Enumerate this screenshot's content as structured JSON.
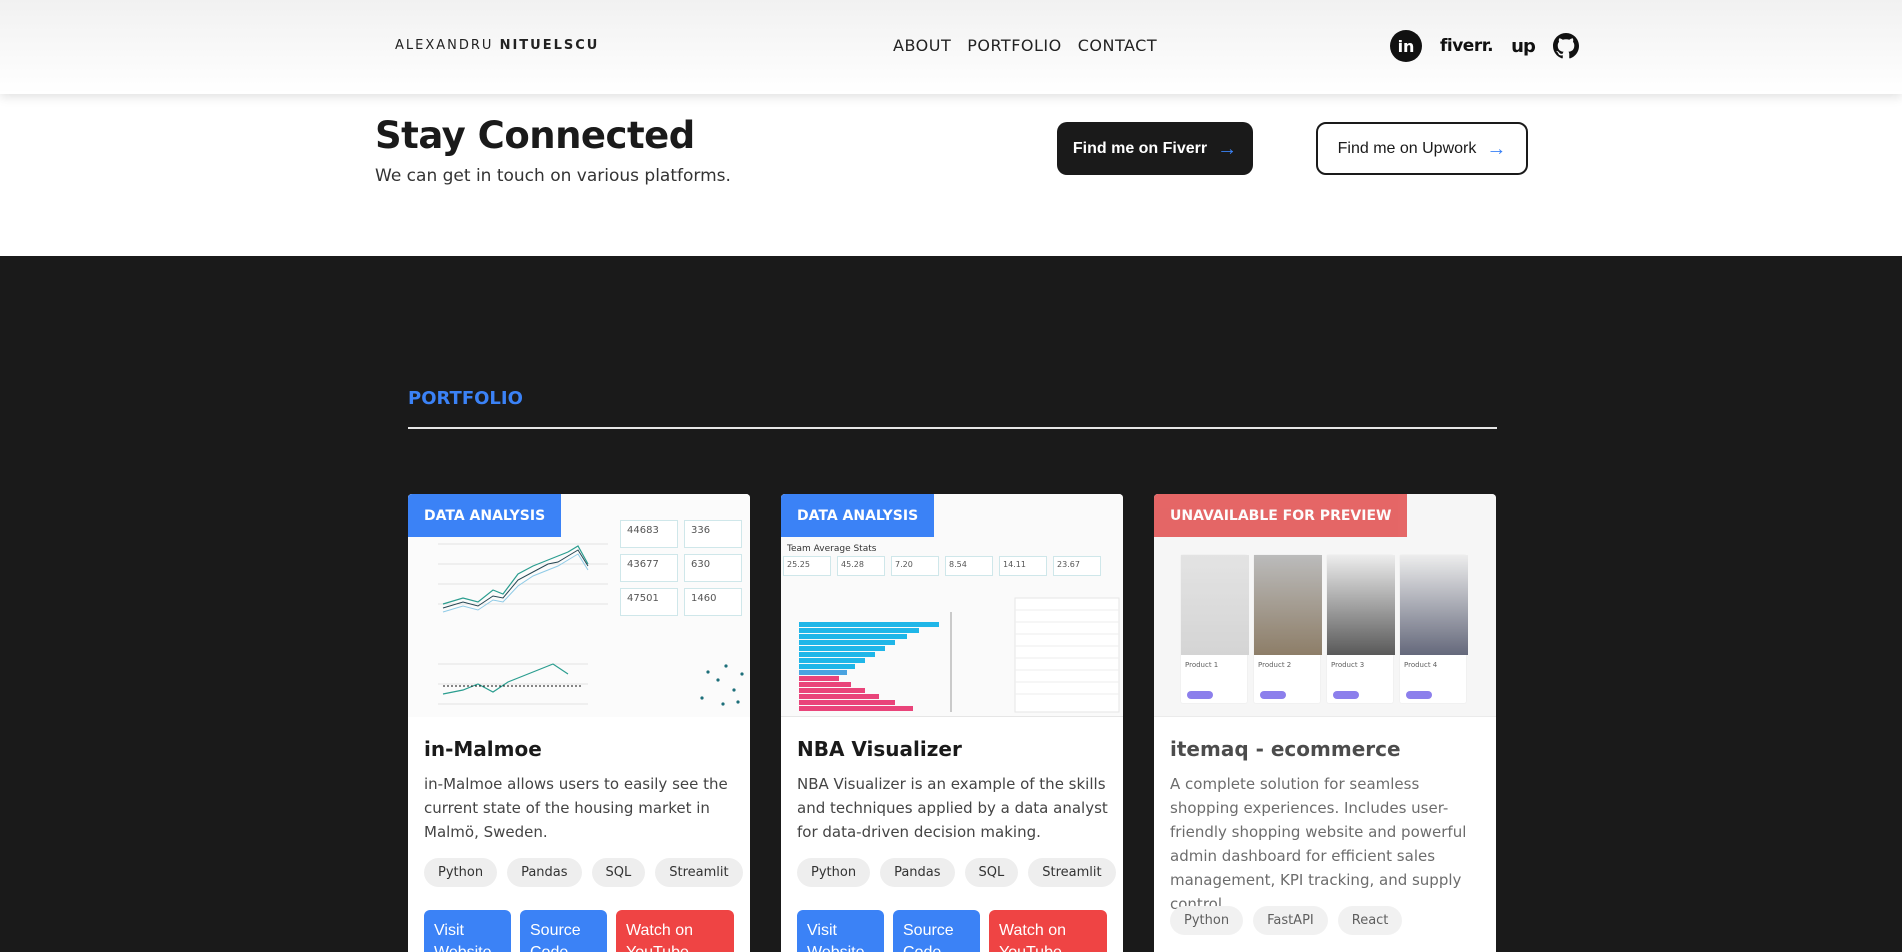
{
  "header": {
    "brand_first": "ALEXANDRU",
    "brand_last": "NITUELSCU",
    "nav": [
      {
        "label": "ABOUT"
      },
      {
        "label": "PORTFOLIO"
      },
      {
        "label": "CONTACT"
      }
    ],
    "socials": {
      "linkedin": "in",
      "fiverr": "fiverr.",
      "upwork": "up"
    }
  },
  "connect": {
    "title": "Stay Connected",
    "subtitle": "We can get in touch on various platforms.",
    "fiverr_button": "Find me on Fiverr",
    "upwork_button": "Find me on Upwork"
  },
  "portfolio": {
    "section_label": "PORTFOLIO",
    "cards": [
      {
        "badge": "DATA ANALYSIS",
        "title": "in-Malmoe",
        "description": "in-Malmoe allows users to easily see the current state of the housing market in Malmö, Sweden.",
        "tags": [
          "Python",
          "Pandas",
          "SQL",
          "Streamlit"
        ],
        "actions": [
          "Visit Website",
          "Source Code",
          "Watch on YouTube"
        ],
        "thumb_stats": [
          "44683",
          "336",
          "43677",
          "630",
          "47501",
          "1460"
        ]
      },
      {
        "badge": "DATA ANALYSIS",
        "title": "NBA Visualizer",
        "description": "NBA Visualizer is an example of the skills and techniques applied by a data analyst for data-driven decision making.",
        "tags": [
          "Python",
          "Pandas",
          "SQL",
          "Streamlit"
        ],
        "actions": [
          "Visit Website",
          "Source Code",
          "Watch on YouTube"
        ],
        "thumb_heading": "Team Average Stats",
        "thumb_stats": [
          "25.25",
          "45.28",
          "7.20",
          "8.54",
          "14.11",
          "23.67"
        ]
      },
      {
        "badge": "UNAVAILABLE FOR PREVIEW",
        "title": "itemaq - ecommerce",
        "description": "A complete solution for seamless shopping experiences. Includes user-friendly shopping website and powerful admin dashboard for efficient sales management, KPI tracking, and supply control.",
        "tags": [
          "Python",
          "FastAPI",
          "React"
        ],
        "products": [
          "Product 1",
          "Product 2",
          "Product 3",
          "Product 4"
        ]
      }
    ]
  },
  "colors": {
    "accent": "#3b82f6",
    "danger": "#ef4444",
    "dark": "#1a1a1a"
  }
}
